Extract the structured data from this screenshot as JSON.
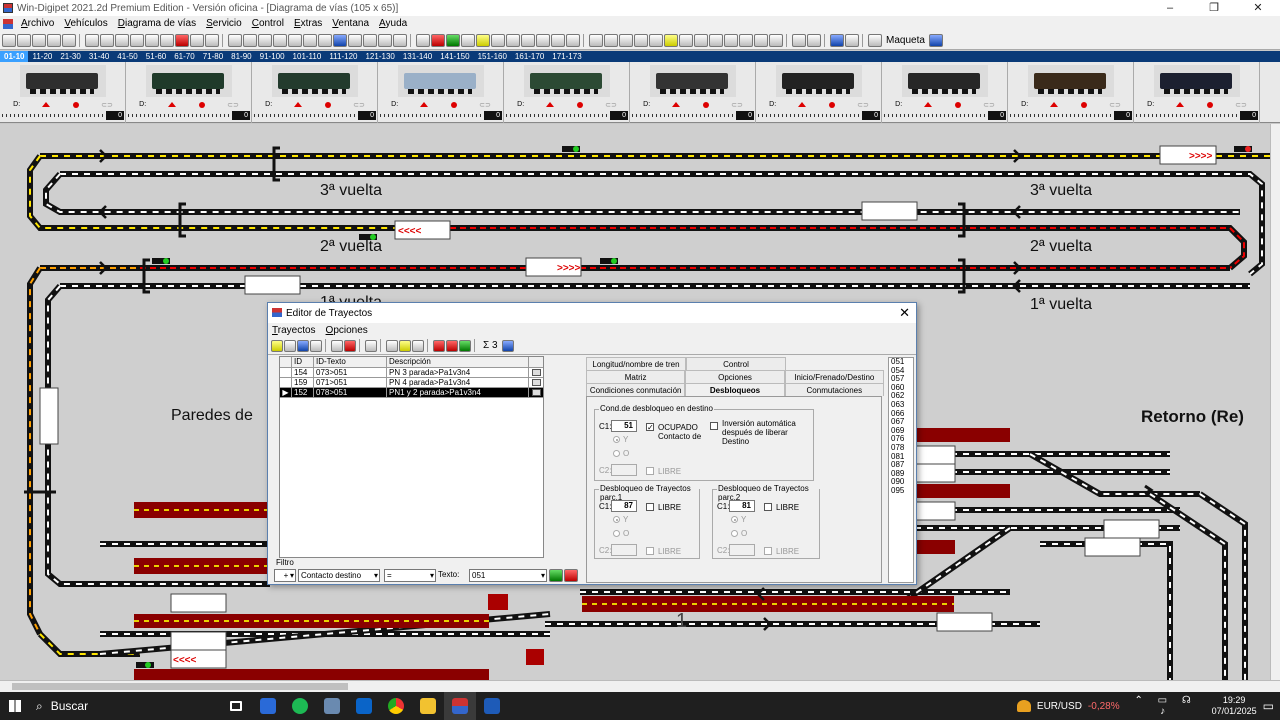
{
  "window": {
    "title": "Win-Digipet 2021.2d Premium Edition - Versión oficina - [Diagrama de vías (105 x 65)]"
  },
  "menu": [
    "Archivo",
    "Vehículos",
    "Diagrama de vías",
    "Servicio",
    "Control",
    "Extras",
    "Ventana",
    "Ayuda"
  ],
  "toolbar": {
    "maqueta_label": "Maqueta"
  },
  "loco_tabs": [
    "01-10",
    "11-20",
    "21-30",
    "31-40",
    "41-50",
    "51-60",
    "61-70",
    "71-80",
    "81-90",
    "91-100",
    "101-110",
    "111-120",
    "121-130",
    "131-140",
    "141-150",
    "151-160",
    "161-170",
    "171-173"
  ],
  "locos": [
    {
      "speed": "0",
      "color": "#2e2e2e"
    },
    {
      "speed": "0",
      "color": "#1f3a2a"
    },
    {
      "speed": "0",
      "color": "#233b2d"
    },
    {
      "speed": "0",
      "color": "#9ab0c8"
    },
    {
      "speed": "0",
      "color": "#2c4a34"
    },
    {
      "speed": "0",
      "color": "#333333"
    },
    {
      "speed": "0",
      "color": "#222222"
    },
    {
      "speed": "0",
      "color": "#262626"
    },
    {
      "speed": "0",
      "color": "#3a2a1a"
    },
    {
      "speed": "0",
      "color": "#1c2030"
    }
  ],
  "loco_ctrl_label": "D:",
  "layout": {
    "labels": {
      "v3_left": "3ª vuelta",
      "v3_right": "3ª vuelta",
      "v2_left": "2ª vuelta",
      "v2_right": "2ª vuelta",
      "v1_left": "1ª vuelta",
      "v1_right": "1ª vuelta",
      "paredes": "Paredes de",
      "retorno": "Retorno (Re)"
    },
    "arrows_right": ">>>>",
    "arrows_left": "<<<<",
    "track_number": "1"
  },
  "dialog": {
    "title": "Editor de Trayectos",
    "menu": [
      "Trayectos",
      "Opciones"
    ],
    "sigma_label": "Σ 3",
    "columns": [
      "ID",
      "ID-Texto",
      "Descripción",
      ""
    ],
    "rows": [
      {
        "id": "154",
        "idtext": "073>051",
        "desc": "PN 3 parada>Pa1v3n4",
        "selected": false
      },
      {
        "id": "159",
        "idtext": "071>051",
        "desc": "PN 4 parada>Pa1v3n4",
        "selected": false
      },
      {
        "id": "152",
        "idtext": "078>051",
        "desc": "PN1 y 2 parada>Pa1v3n4",
        "selected": true
      }
    ],
    "tabs_row1": [
      "Longitud/nombre de tren",
      "Control"
    ],
    "tabs_row2": [
      "Matriz",
      "Opciones",
      "Inicio/Frenado/Destino"
    ],
    "tabs_row3": [
      "Condiciones conmutación",
      "Desbloqueos",
      "Conmutaciones encadenadas"
    ],
    "active_tab": "Desbloqueos",
    "cond_group": "Cond.de desbloqueo en destino",
    "c1_label": "C1:",
    "c1_value": "51",
    "ocupado": "OCUPADO",
    "contacto": "Contacto de",
    "y_label": "Y",
    "o_label": "O",
    "c2_label": "C2:",
    "libre": "LIBRE",
    "inversion": "Inversión automática después de liberar Destino",
    "parc1_group": "Desbloqueo de Trayectos parc.1",
    "parc1_c1": "87",
    "parc2_group": "Desbloqueo de Trayectos parc.2",
    "parc2_c1": "81",
    "numbers": [
      "051",
      "054",
      "057",
      "060",
      "062",
      "063",
      "066",
      "067",
      "069",
      "076",
      "078",
      "081",
      "087",
      "089",
      "090",
      "095"
    ],
    "filter": {
      "label": "Filtro",
      "field": "Contacto destino",
      "op": "=",
      "text_label": "Texto:",
      "text_value": "051"
    }
  },
  "taskbar": {
    "search": "Buscar",
    "ticker": "EUR/USD",
    "ticker_change": "-0,28%",
    "time": "19:29",
    "date": "07/01/2025"
  }
}
